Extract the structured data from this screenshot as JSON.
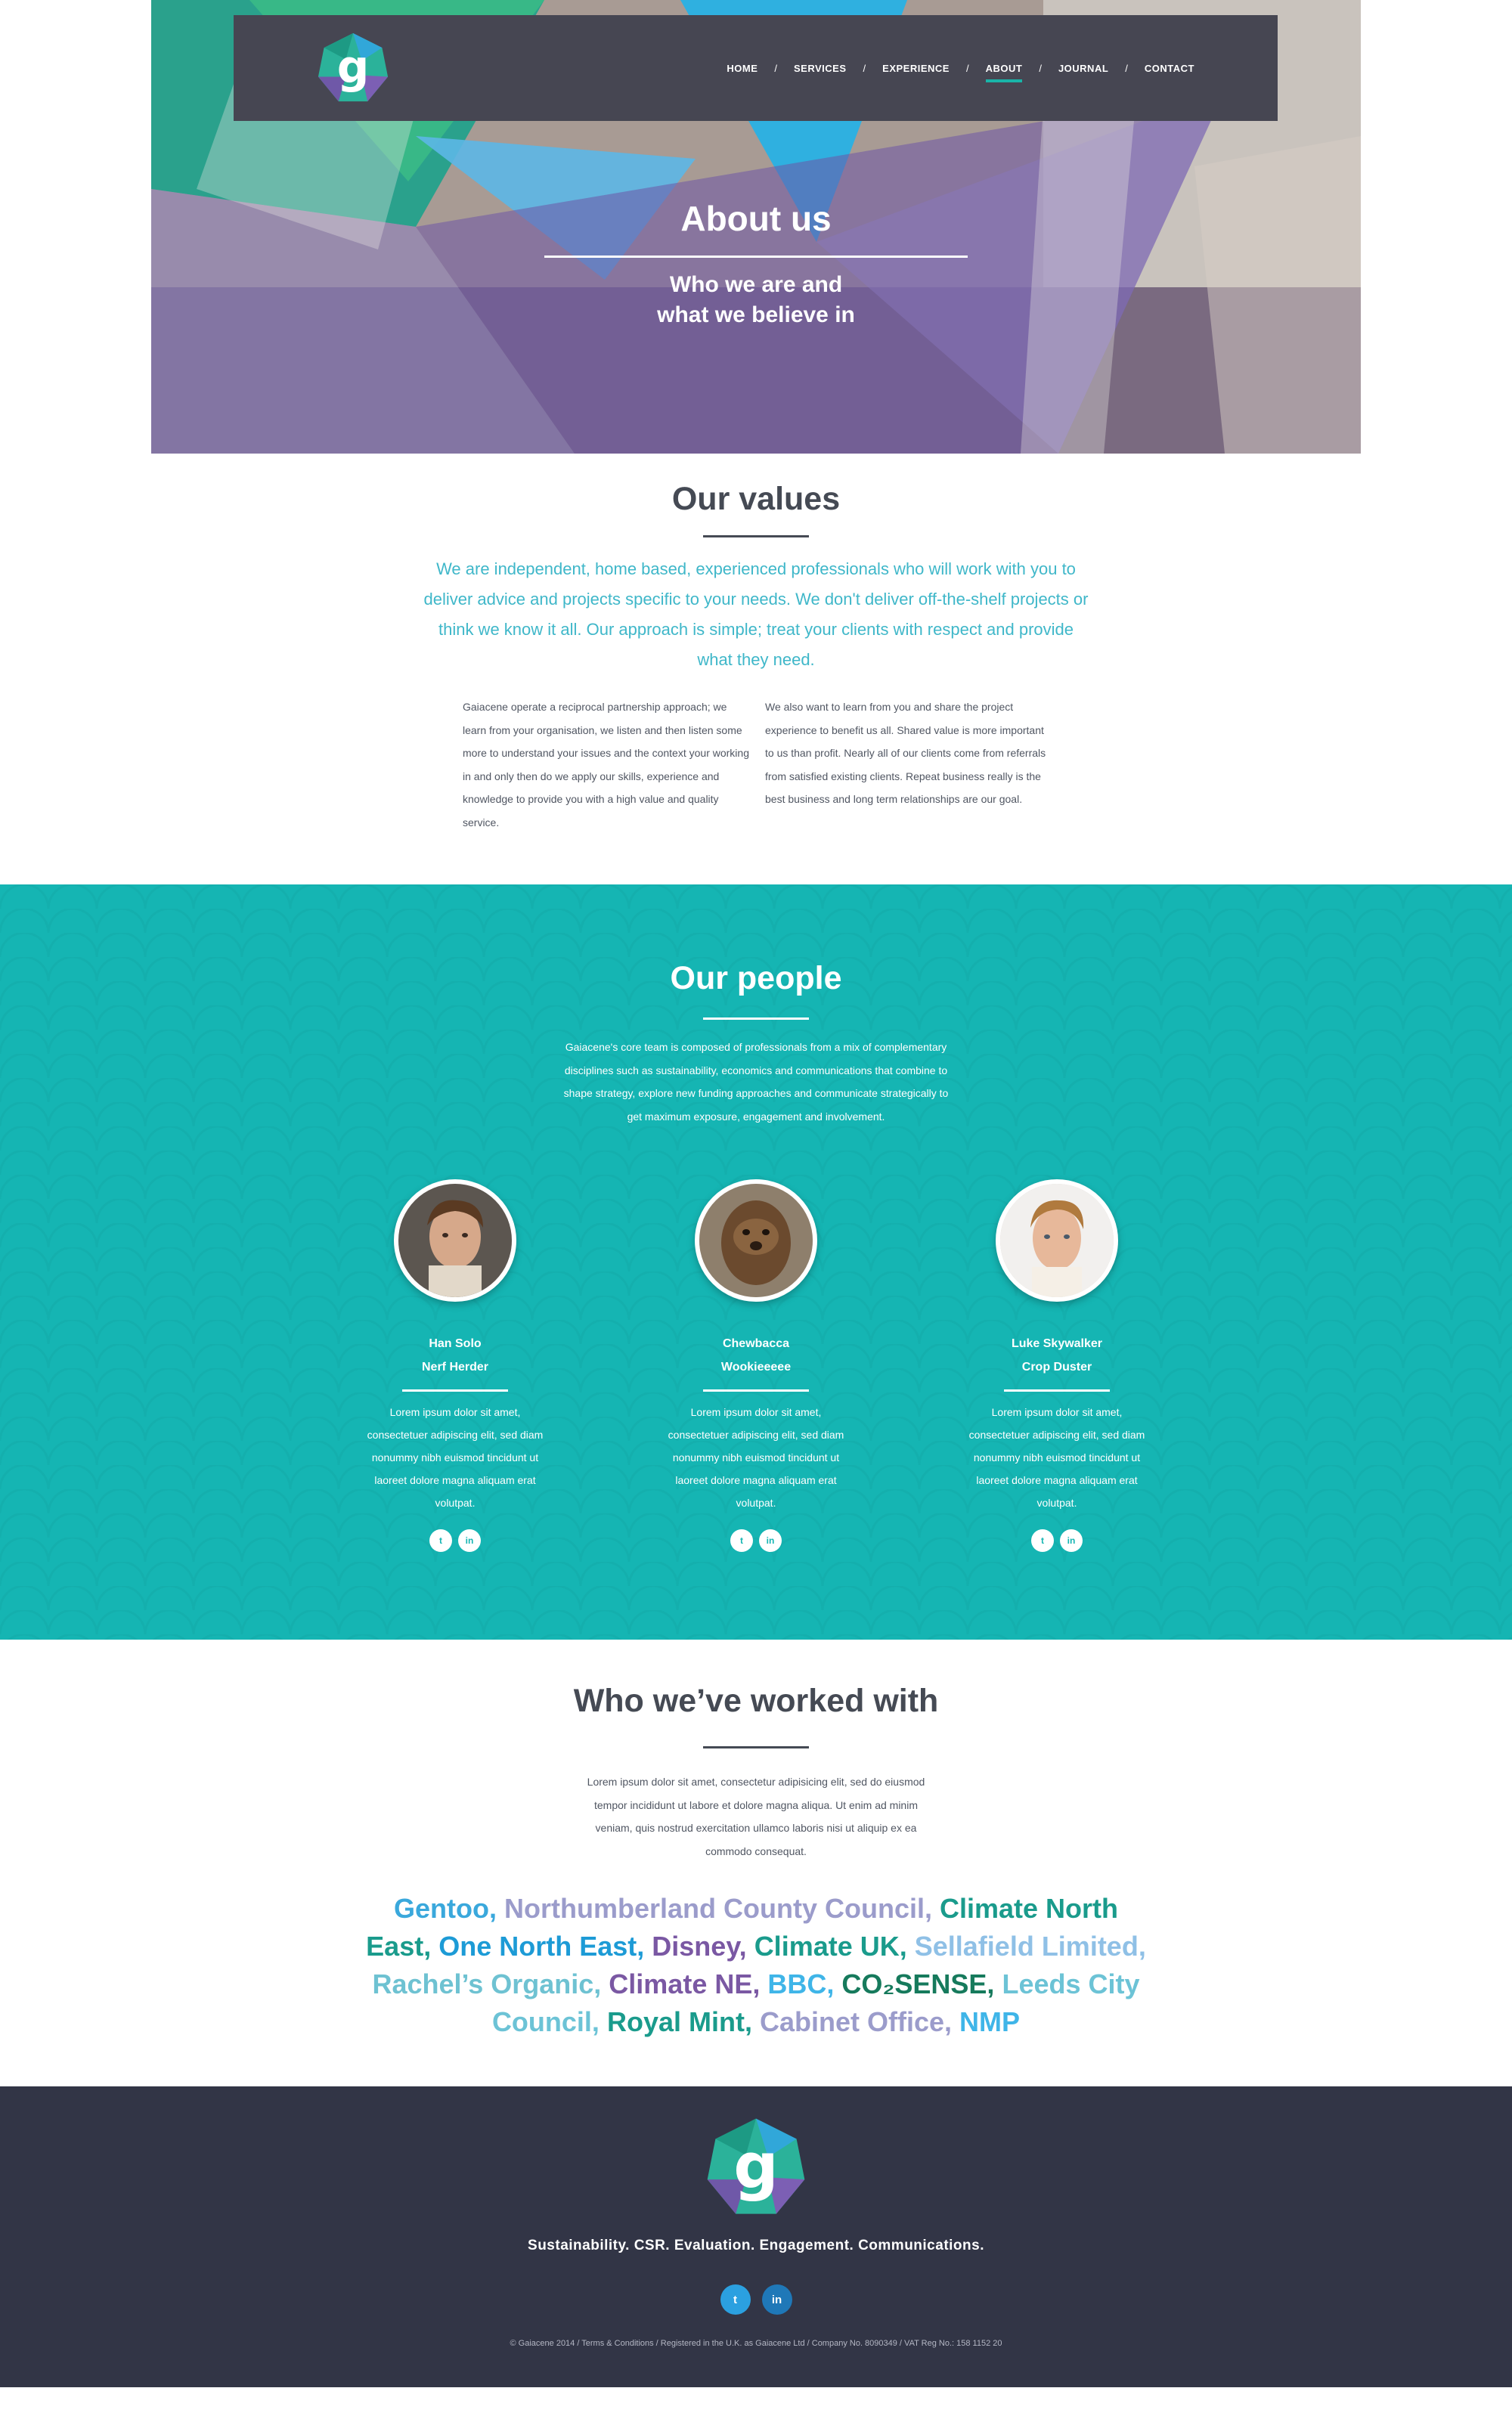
{
  "nav": {
    "logo_letter": "g",
    "items": [
      "HOME",
      "SERVICES",
      "EXPERIENCE",
      "ABOUT",
      "JOURNAL",
      "CONTACT"
    ],
    "separator": "/",
    "active": "ABOUT"
  },
  "hero": {
    "title": "About us",
    "subtitle_line1": "Who we are and",
    "subtitle_line2": "what we believe in"
  },
  "values": {
    "title": "Our values",
    "lead": "We are independent, home based, experienced professionals who will work with you to deliver advice and projects specific to your needs. We don't deliver off-the-shelf projects or think we know it all. Our approach is simple; treat your clients with respect and provide what they need.",
    "col1": "Gaiacene operate a reciprocal partnership approach; we learn from your organisation, we listen and then listen some more to understand your issues and the context your working in and only then do we apply our skills, experience and knowledge to provide you with a high value and quality service.",
    "col2": "We also want to learn from you and share the project experience to benefit us all. Shared value is more important to us than profit. Nearly all of our clients come from referrals from satisfied existing clients. Repeat business really is the best business and long term relationships are our goal."
  },
  "people": {
    "title": "Our people",
    "intro": "Gaiacene's core team is composed of professionals from a mix of complementary disciplines such as sustainability, economics and communications that combine to shape strategy, explore new funding approaches and communicate strategically to get maximum exposure, engagement and involvement.",
    "members": [
      {
        "name": "Han Solo",
        "role": "Nerf Herder",
        "bio": "Lorem ipsum dolor sit amet, consectetuer adipiscing elit, sed diam nonummy nibh euismod tincidunt ut laoreet dolore magna aliquam erat volutpat."
      },
      {
        "name": "Chewbacca",
        "role": "Wookieeeee",
        "bio": "Lorem ipsum dolor sit amet, consectetuer adipiscing elit, sed diam nonummy nibh euismod tincidunt ut laoreet dolore magna aliquam erat volutpat."
      },
      {
        "name": "Luke Skywalker",
        "role": "Crop Duster",
        "bio": "Lorem ipsum dolor sit amet, consectetuer adipiscing elit, sed diam nonummy nibh euismod tincidunt ut laoreet dolore magna aliquam erat volutpat."
      }
    ],
    "twitter_glyph": "t",
    "linkedin_glyph": "in"
  },
  "clients": {
    "title": "Who we’ve worked with",
    "intro": "Lorem ipsum dolor sit amet, consectetur adipisicing elit, sed do eiusmod tempor incididunt ut labore et dolore magna aliqua. Ut enim ad minim veniam, quis nostrud exercitation ullamco laboris nisi ut aliquip ex ea commodo consequat.",
    "names": [
      {
        "text": "Gentoo,",
        "color": "#3aa8dc"
      },
      {
        "text": "Northumberland County Council,",
        "color": "#9b9ccb"
      },
      {
        "text": "Climate North East,",
        "color": "#1a9b8c"
      },
      {
        "text": "One North East,",
        "color": "#1d9bd6"
      },
      {
        "text": "Disney,",
        "color": "#7a58a3"
      },
      {
        "text": "Climate UK,",
        "color": "#1a9b8c"
      },
      {
        "text": "Sellafield Limited,",
        "color": "#8fc0e6"
      },
      {
        "text": "Rachel’s Organic,",
        "color": "#6ec2d2"
      },
      {
        "text": "Climate NE,",
        "color": "#7a58a3"
      },
      {
        "text": "BBC,",
        "color": "#3fb5e8"
      },
      {
        "text": "CO₂SENSE,",
        "color": "#167a5c"
      },
      {
        "text": "Leeds City Council,",
        "color": "#6cc3d6"
      },
      {
        "text": "Royal Mint,",
        "color": "#1a9b8c"
      },
      {
        "text": "Cabinet Office,",
        "color": "#9b9ccb"
      },
      {
        "text": "NMP",
        "color": "#3fb5e8"
      }
    ]
  },
  "footer": {
    "tagline": "Sustainability. CSR. Evaluation. Engagement. Communications.",
    "twitter_glyph": "t",
    "linkedin_glyph": "in",
    "legal": "© Gaiacene 2014  /  Terms & Conditions /  Registered in the U.K. as Gaiacene Ltd  /  Company No. 8090349 / VAT Reg No.: 158 1152 20"
  },
  "colors": {
    "teal": "#15b5b3",
    "dark_nav": "#464652",
    "footer_bg": "#323546",
    "lead_blue": "#3fb7c9",
    "heading": "#454a54"
  }
}
